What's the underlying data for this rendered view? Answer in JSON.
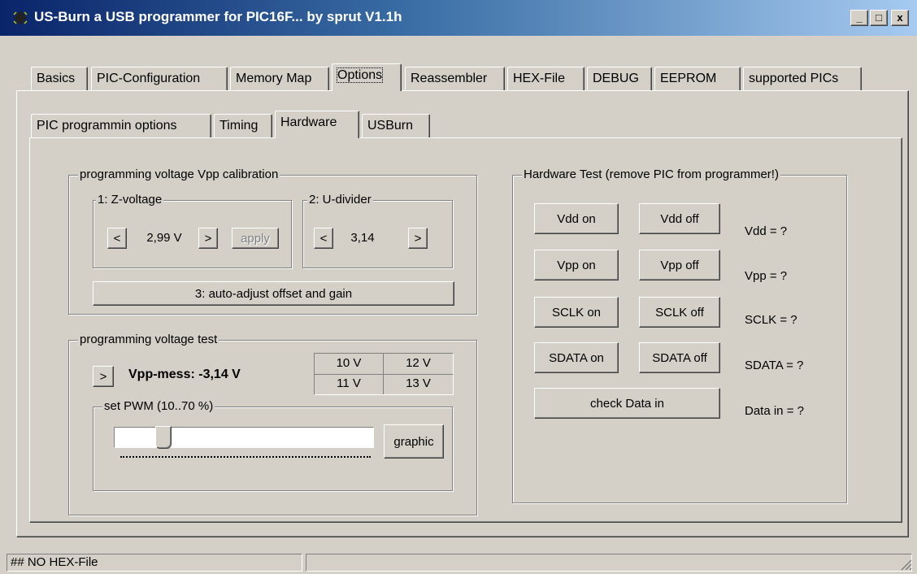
{
  "window": {
    "title": "US-Burn  a USB programmer for PIC16F...  by sprut V1.1h",
    "controls": {
      "minimize": "_",
      "maximize": "□",
      "close": "x"
    }
  },
  "tabs": [
    {
      "label": "Basics"
    },
    {
      "label": "PIC-Configuration"
    },
    {
      "label": "Memory Map"
    },
    {
      "label": "Options"
    },
    {
      "label": "Reassembler"
    },
    {
      "label": "HEX-File"
    },
    {
      "label": "DEBUG"
    },
    {
      "label": "EEPROM"
    },
    {
      "label": "supported PICs"
    }
  ],
  "subtabs": [
    {
      "label": "PIC programmin options"
    },
    {
      "label": "Timing"
    },
    {
      "label": "Hardware"
    },
    {
      "label": "USBurn"
    }
  ],
  "calibration": {
    "title": "programming voltage  Vpp calibration",
    "zvoltage": {
      "title": "1: Z-voltage",
      "dec": "<",
      "value": "2,99 V",
      "inc": ">",
      "apply": "apply"
    },
    "udivider": {
      "title": "2: U-divider",
      "dec": "<",
      "value": "3,14",
      "inc": ">"
    },
    "auto_adjust": "3: auto-adjust offset and gain"
  },
  "voltage_test": {
    "title": "programming voltage test",
    "run": ">",
    "vpp_mess": "Vpp-mess:  -3,14 V",
    "grid": [
      "10 V",
      "12 V",
      "11 V",
      "13 V"
    ],
    "pwm": {
      "title": "set PWM (10..70 %)",
      "graphic": "graphic",
      "level_fraction": 0.1
    }
  },
  "hardware_test": {
    "title": "Hardware Test (remove PIC from programmer!)",
    "rows": [
      {
        "on": "Vdd on",
        "off": "Vdd off",
        "status": "Vdd = ?"
      },
      {
        "on": "Vpp on",
        "off": "Vpp off",
        "status": "Vpp = ?"
      },
      {
        "on": "SCLK on",
        "off": "SCLK off",
        "status": "SCLK = ?"
      },
      {
        "on": "SDATA on",
        "off": "SDATA off",
        "status": "SDATA = ?"
      }
    ],
    "check": "check Data in",
    "data_in": "Data in = ?"
  },
  "statusbar": {
    "file": "## NO HEX-File",
    "info": ""
  },
  "colors": {
    "face": "#d4d0c8",
    "title_start": "#0a246a",
    "title_end": "#a6caf0",
    "shadow": "#808080"
  }
}
